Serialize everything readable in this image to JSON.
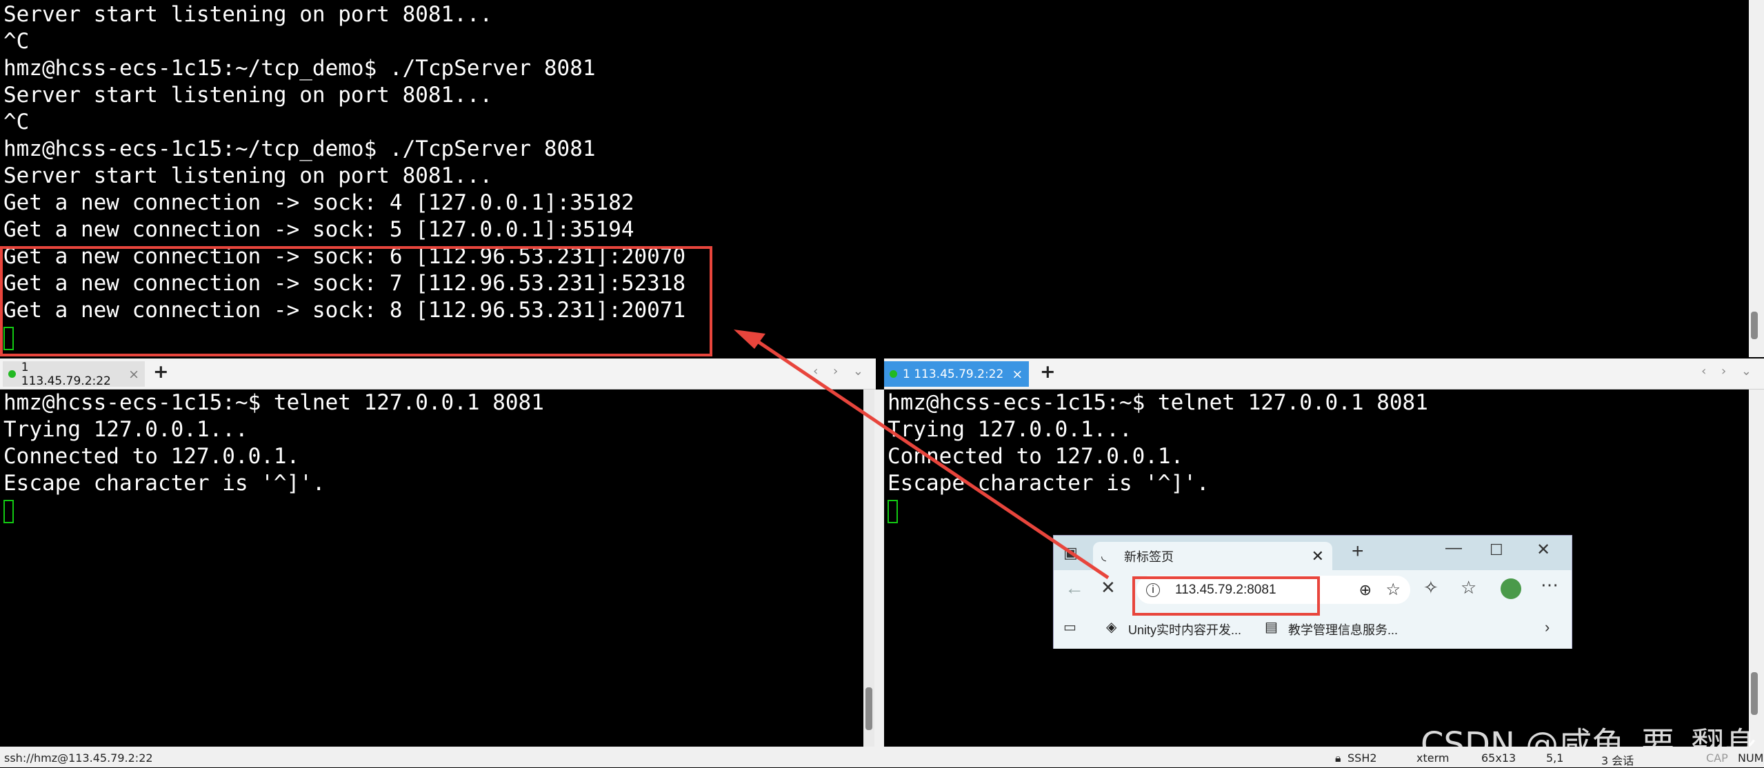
{
  "top_terminal": {
    "lines": [
      "Server start listening on port 8081...",
      "^C",
      "hmz@hcss-ecs-1c15:~/tcp_demo$ ./TcpServer 8081",
      "Server start listening on port 8081...",
      "^C",
      "hmz@hcss-ecs-1c15:~/tcp_demo$ ./TcpServer 8081",
      "Server start listening on port 8081...",
      "Get a new connection -> sock: 4 [127.0.0.1]:35182",
      "Get a new connection -> sock: 5 [127.0.0.1]:35194",
      "Get a new connection -> sock: 6 [112.96.53.231]:20070",
      "Get a new connection -> sock: 7 [112.96.53.231]:52318",
      "Get a new connection -> sock: 8 [112.96.53.231]:20071"
    ]
  },
  "left_tabbar": {
    "tab_label": "1 113.45.79.2:22",
    "close": "×",
    "add": "+",
    "nav": "‹ › ⌄"
  },
  "right_tabbar": {
    "tab_label": "1 113.45.79.2:22",
    "close": "×",
    "add": "+",
    "nav": "‹ › ⌄"
  },
  "left_terminal": {
    "lines": [
      "hmz@hcss-ecs-1c15:~$ telnet 127.0.0.1 8081",
      "Trying 127.0.0.1...",
      "Connected to 127.0.0.1.",
      "Escape character is '^]'."
    ]
  },
  "right_terminal": {
    "lines": [
      "hmz@hcss-ecs-1c15:~$ telnet 127.0.0.1 8081",
      "Trying 127.0.0.1...",
      "Connected to 127.0.0.1.",
      "Escape character is '^]'."
    ]
  },
  "browser": {
    "tab_title": "新标签页",
    "address": "113.45.79.2:8081",
    "favorites": [
      "Unity实时内容开发...",
      "教学管理信息服务..."
    ],
    "icons": [
      "sidebar-icon",
      "back-icon",
      "stop-icon",
      "info-icon",
      "zoom-icon",
      "star-icon",
      "extensions-icon",
      "favorites-icon",
      "profile-icon",
      "more-icon"
    ]
  },
  "statusbar": {
    "connection": "ssh://hmz@113.45.79.2:22",
    "protocol": "SSH2",
    "term_type": "xterm",
    "size": "65x13",
    "cursor_pos": "5,1",
    "sessions": "3 会话",
    "caps": "CAP",
    "num": "NUM"
  },
  "watermark": "CSDN @咸鱼_要_翻身",
  "colors": {
    "annotation_red": "#e8453c",
    "terminal_bg": "#000000",
    "cursor_green": "#12c912",
    "active_tab_blue": "#3b95e3"
  }
}
